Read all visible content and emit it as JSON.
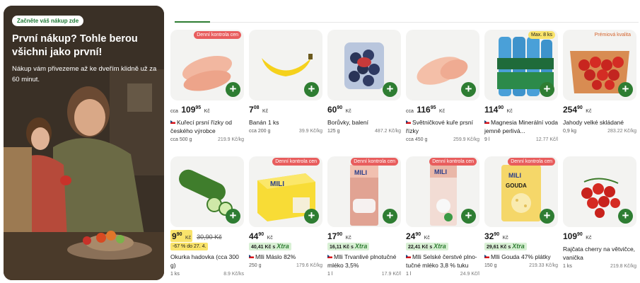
{
  "promo": {
    "badge": "Začněte váš nákup zde",
    "title": "První nákup? Tohle berou všichni jako první!",
    "subtitle": "Nákup vám přivezeme až ke dveřím klidně už za 60 minut."
  },
  "colors": {
    "accent": "#2e7d32",
    "tag_red": "#e85d5d",
    "highlight": "#f9e36b",
    "xtra": "#d8f0d4"
  },
  "products": [
    {
      "tag": "Denní kontrola cen",
      "ca": "cca",
      "price_int": "109",
      "price_dec": "95",
      "currency": "Kč",
      "name": "Kuřecí prsní řízky od českého výrobce",
      "cz": true,
      "qty": "cca 500 g",
      "unit_price": "219.9 Kč/kg",
      "add": "+"
    },
    {
      "tag": "",
      "ca": "",
      "price_int": "7",
      "price_dec": "08",
      "currency": "Kč",
      "name": "Banán 1 ks",
      "cz": false,
      "qty": "cca 200 g",
      "unit_price": "39.9 Kč/kg",
      "add": "+"
    },
    {
      "tag": "",
      "ca": "",
      "price_int": "60",
      "price_dec": "90",
      "currency": "Kč",
      "name": "Borůvky, balení",
      "cz": false,
      "qty": "125 g",
      "unit_price": "487.2 Kč/kg",
      "add": "+"
    },
    {
      "tag": "",
      "ca": "cca",
      "price_int": "116",
      "price_dec": "95",
      "currency": "Kč",
      "name": "Světničkové kuře prsní řízky",
      "cz": true,
      "qty": "cca 450 g",
      "unit_price": "259.9 Kč/kg",
      "add": "+"
    },
    {
      "tag": "Max. 8 ks",
      "ca": "",
      "price_int": "114",
      "price_dec": "90",
      "currency": "Kč",
      "name": "Magnesia Minerální voda jemně perlivá...",
      "cz": true,
      "qty": "9 l",
      "unit_price": "12.77 Kč/l",
      "add": "+"
    },
    {
      "tag": "Prémiová kvalita",
      "ca": "",
      "price_int": "254",
      "price_dec": "90",
      "currency": "Kč",
      "name": "Jahody velké skládané",
      "cz": false,
      "qty": "0,9 kg",
      "unit_price": "283.22 Kč/kg",
      "add": "+"
    },
    {
      "tag": "",
      "ca": "",
      "price_int": "9",
      "price_dec": "90",
      "currency": "Kč",
      "old_price": "30,90 Kč",
      "discount": "-67 % do 27. 4.",
      "name": "Okurka hadovka (cca 300 g)",
      "cz": false,
      "qty": "1 ks",
      "unit_price": "8.9 Kč/ks",
      "add": "+"
    },
    {
      "tag": "Denní kontrola cen",
      "ca": "",
      "price_int": "44",
      "price_dec": "90",
      "currency": "Kč",
      "xtra_price": "40,41 Kč s",
      "xtra": "Xtra",
      "name": "Mlli Máslo 82%",
      "cz": true,
      "qty": "250 g",
      "unit_price": "179.6 Kč/kg",
      "add": "+"
    },
    {
      "tag": "Denní kontrola cen",
      "ca": "",
      "price_int": "17",
      "price_dec": "90",
      "currency": "Kč",
      "xtra_price": "16,11 Kč s",
      "xtra": "Xtra",
      "name": "Mlli Trvanlivé plnotučné mléko 3,5%",
      "cz": true,
      "qty": "1 l",
      "unit_price": "17.9 Kč/l",
      "add": "+"
    },
    {
      "tag": "Denní kontrola cen",
      "ca": "",
      "price_int": "24",
      "price_dec": "90",
      "currency": "Kč",
      "xtra_price": "22,41 Kč s",
      "xtra": "Xtra",
      "name": "Mlli Selské čerstvé plno-tučné mléko 3,8 % tuku",
      "cz": true,
      "qty": "1 l",
      "unit_price": "24.9 Kč/l",
      "add": "+"
    },
    {
      "tag": "Denní kontrola cen",
      "ca": "",
      "price_int": "32",
      "price_dec": "90",
      "currency": "Kč",
      "xtra_price": "29,61 Kč s",
      "xtra": "Xtra",
      "name": "Mlli Gouda 47% plátky",
      "cz": true,
      "qty": "150 g",
      "unit_price": "219.33 Kč/kg",
      "add": "+"
    },
    {
      "tag": "",
      "ca": "",
      "price_int": "109",
      "price_dec": "90",
      "currency": "Kč",
      "name": "Rajčata cherry na větvičce, vanička",
      "cz": false,
      "qty": "1 ks",
      "unit_price": "219.8 Kč/kg",
      "add": "+"
    }
  ]
}
